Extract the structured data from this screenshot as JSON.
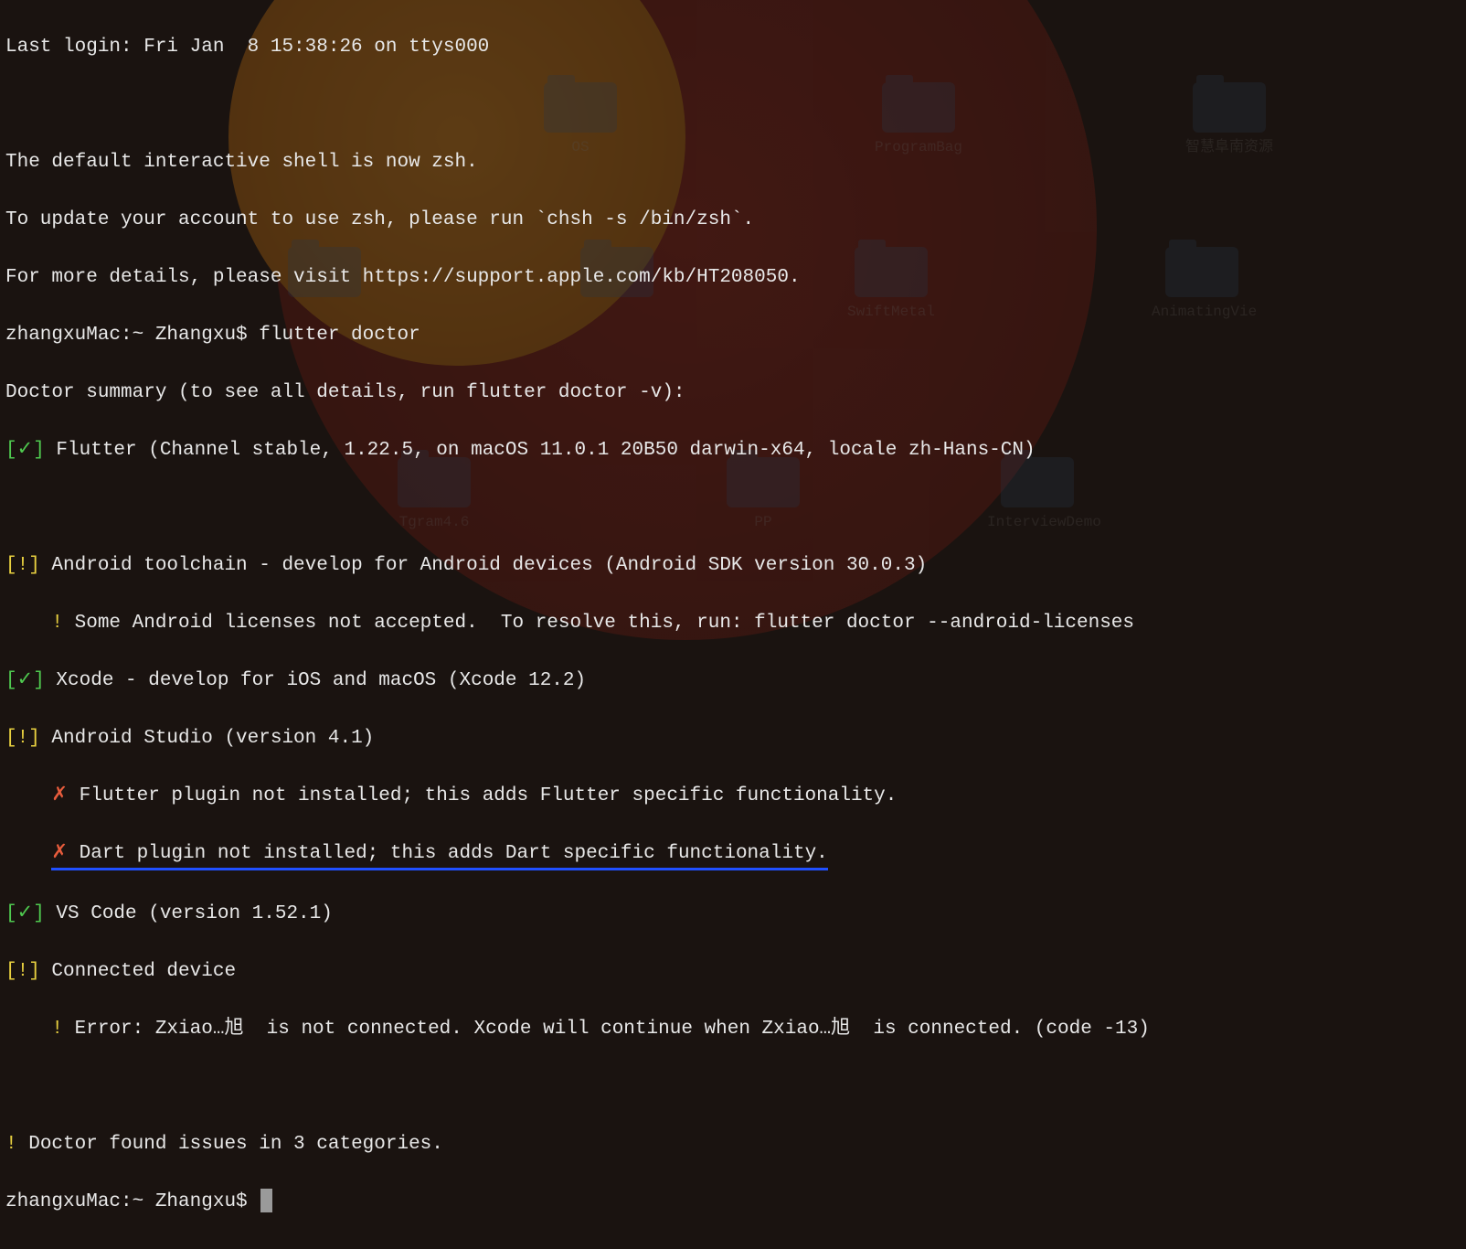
{
  "desktop_folders": [
    {
      "label": "OS"
    },
    {
      "label": "ProgramBag"
    },
    {
      "label": "智慧阜南资源"
    },
    {
      "label": ""
    },
    {
      "label": ""
    },
    {
      "label": "SwiftMetal"
    },
    {
      "label": "AnimatingVie"
    },
    {
      "label": "Tgram4.6"
    },
    {
      "label": "PP"
    },
    {
      "label": "InterviewDemo"
    }
  ],
  "lines": {
    "last_login": "Last login: Fri Jan  8 15:38:26 on ttys000",
    "zsh1": "The default interactive shell is now zsh.",
    "zsh2": "To update your account to use zsh, please run `chsh -s /bin/zsh`.",
    "zsh3": "For more details, please visit https://support.apple.com/kb/HT208050.",
    "prompt1": "zhangxuMac:~ Zhangxu$ flutter doctor",
    "doctor_summary": "Doctor summary (to see all details, run flutter doctor -v):",
    "flutter_status": "[✓]",
    "flutter_text": " Flutter (Channel stable, 1.22.5, on macOS 11.0.1 20B50 darwin-x64, locale zh-Hans-CN)",
    "android_status": "[!]",
    "android_text": " Android toolchain - develop for Android devices (Android SDK version 30.0.3)",
    "android_sub_mark": "    !",
    "android_sub_text": " Some Android licenses not accepted.  To resolve this, run: flutter doctor --android-licenses",
    "xcode_status": "[✓]",
    "xcode_text": " Xcode - develop for iOS and macOS (Xcode 12.2)",
    "astudio_status": "[!]",
    "astudio_text": " Android Studio (version 4.1)",
    "astudio_sub1_mark": "    ✗",
    "astudio_sub1_text": " Flutter plugin not installed; this adds Flutter specific functionality.",
    "astudio_sub2_pad": "    ",
    "astudio_sub2_mark": "✗",
    "astudio_sub2_text": " Dart plugin not installed; this adds Dart specific functionality.",
    "vscode_status": "[✓]",
    "vscode_text": " VS Code (version 1.52.1)",
    "device_status": "[!]",
    "device_text": " Connected device",
    "device_sub_mark": "    !",
    "device_sub_text": " Error: Zxiao…旭  is not connected. Xcode will continue when Zxiao…旭  is connected. (code -13)",
    "summary_mark": "!",
    "summary_text": " Doctor found issues in 3 categories.",
    "prompt2": "zhangxuMac:~ Zhangxu$ "
  }
}
